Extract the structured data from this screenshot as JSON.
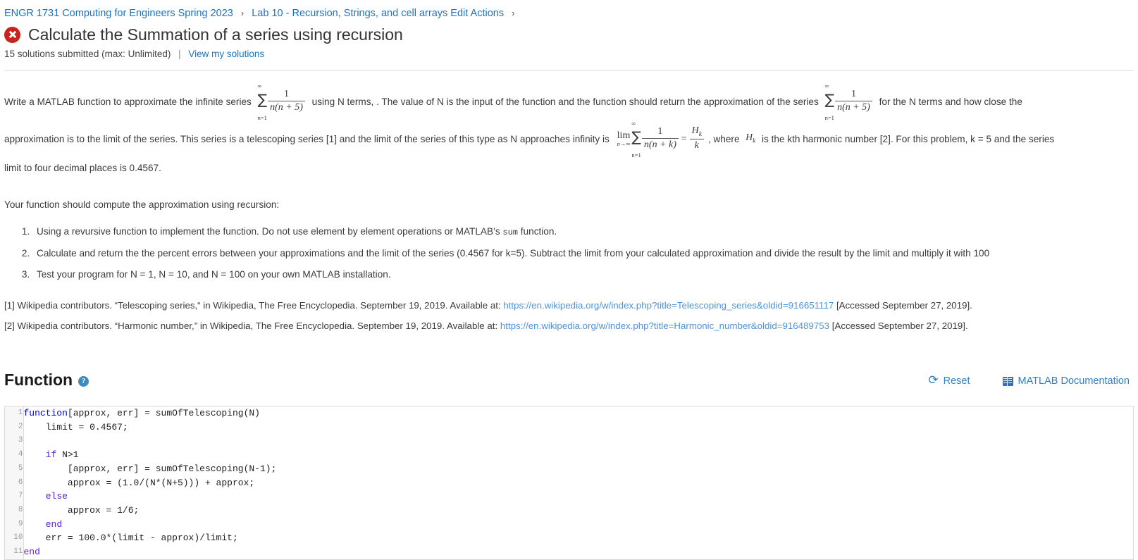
{
  "breadcrumb": {
    "items": [
      "ENGR 1731 Computing for Engineers Spring 2023",
      "Lab 10 - Recursion, Strings, and cell arrays Edit Actions"
    ],
    "separator": "›"
  },
  "header": {
    "status_icon": "error-circle-x-icon",
    "title": "Calculate the Summation of a series using recursion",
    "submissions": "15 solutions submitted (max: Unlimited)",
    "divider": "|",
    "view_solutions_link": "View my solutions"
  },
  "description": {
    "para1_a": "Write a MATLAB function to approximate the infinite series",
    "para1_b": "using N terms, . The value of N is the input of the function and the function should return the approximation of the series",
    "para1_c": "for the N terms and how close the",
    "para2_a": "approximation is to the limit of the series. This series is a telescoping series [1] and the limit of the series of this type as N approaches infinity is",
    "para2_b": ", where",
    "para2_c": "is the kth harmonic number [2]. For this problem, k = 5 and the series",
    "para3": "limit to four decimal places is 0.4567.",
    "formula1": {
      "sum_upper": "∞",
      "sum_lower": "n=1",
      "numerator": "1",
      "denominator": "n(n + 5)"
    },
    "formula2": {
      "sum_upper": "∞",
      "sum_lower": "n=1",
      "numerator": "1",
      "denominator": "n(n + 5)"
    },
    "formula3": {
      "lim_top": "lim",
      "lim_bottom": "n→∞",
      "sum_upper": "∞",
      "sum_lower": "n=1",
      "numerator": "1",
      "denominator": "n(n + k)",
      "equals": "=",
      "rhs_numerator": "H",
      "rhs_numerator_sub": "k",
      "rhs_denominator": "k"
    },
    "harmonic_symbol": "H",
    "harmonic_symbol_sub": "k"
  },
  "instructions": {
    "lead": "Your function should compute the approximation using recursion:",
    "steps": [
      {
        "text_a": "Using a revursive function to implement the function. Do not use element by element operations or MATLAB’s",
        "code": "sum",
        "text_b": "function."
      },
      {
        "text_a": "Calculate and return the the percent errors between your approximations and the limit of the series (0.4567 for k=5). Subtract the limit from your calculated approximation and divide the result by the limit and multiply it with 100",
        "code": "",
        "text_b": ""
      },
      {
        "text_a": "Test your program for N = 1, N = 10, and N = 100 on your own MATLAB installation.",
        "code": "",
        "text_b": ""
      }
    ]
  },
  "references": [
    {
      "prefix": "[1] Wikipedia contributors. “Telescoping series,“ in Wikipedia, The Free Encyclopedia. September 19, 2019. Available at:",
      "url": "https://en.wikipedia.org/w/index.php?title=Telescoping_series&oldid=916651117",
      "suffix": "[Accessed September 27, 2019]."
    },
    {
      "prefix": "[2] Wikipedia contributors. “Harmonic number,” in Wikipedia, The Free Encyclopedia. September 19, 2019. Available at:",
      "url": "https://en.wikipedia.org/w/index.php?title=Harmonic_number&oldid=916489753",
      "suffix": "[Accessed September 27, 2019]."
    }
  ],
  "function_section": {
    "title": "Function",
    "help_icon": "question-mark-help-icon",
    "help_glyph": "?",
    "reset_label": "Reset",
    "reset_icon": "refresh-icon",
    "reset_glyph": "⟳",
    "doc_label": "MATLAB Documentation",
    "doc_icon": "book-icon"
  },
  "editor": {
    "line_numbers": [
      "1",
      "2",
      "3",
      "4",
      "5",
      "6",
      "7",
      "8",
      "9",
      "10",
      "11"
    ],
    "lines": [
      {
        "indent": "",
        "tokens": [
          {
            "t": "function",
            "c": "kw"
          },
          {
            "t": "[approx, err] = sumOfTelescoping(N)",
            "c": ""
          }
        ]
      },
      {
        "indent": "    ",
        "tokens": [
          {
            "t": "limit = 0.4567;",
            "c": ""
          }
        ]
      },
      {
        "indent": "",
        "tokens": [
          {
            "t": "",
            "c": ""
          }
        ]
      },
      {
        "indent": "    ",
        "tokens": [
          {
            "t": "if",
            "c": "kw2"
          },
          {
            "t": " N>1",
            "c": ""
          }
        ]
      },
      {
        "indent": "        ",
        "tokens": [
          {
            "t": "[approx, err] = sumOfTelescoping(N-1);",
            "c": ""
          }
        ]
      },
      {
        "indent": "        ",
        "tokens": [
          {
            "t": "approx = (1.0/(N*(N+5))) + approx;",
            "c": ""
          }
        ]
      },
      {
        "indent": "    ",
        "tokens": [
          {
            "t": "else",
            "c": "kw2"
          }
        ]
      },
      {
        "indent": "        ",
        "tokens": [
          {
            "t": "approx = 1/6;",
            "c": ""
          }
        ]
      },
      {
        "indent": "    ",
        "tokens": [
          {
            "t": "end",
            "c": "kw2"
          }
        ]
      },
      {
        "indent": "    ",
        "tokens": [
          {
            "t": "err = 100.0*(limit - approx)/limit;",
            "c": ""
          }
        ]
      },
      {
        "indent": "",
        "tokens": [
          {
            "t": "end",
            "c": "kw2"
          }
        ]
      }
    ]
  },
  "colors": {
    "link": "#1a73c4",
    "ref_link": "#4d93d9",
    "error_red": "#c9241c",
    "accent_blue": "#2f7fc4",
    "keyword_blue": "#0000dd",
    "keyword_purple": "#5a1ecd"
  }
}
